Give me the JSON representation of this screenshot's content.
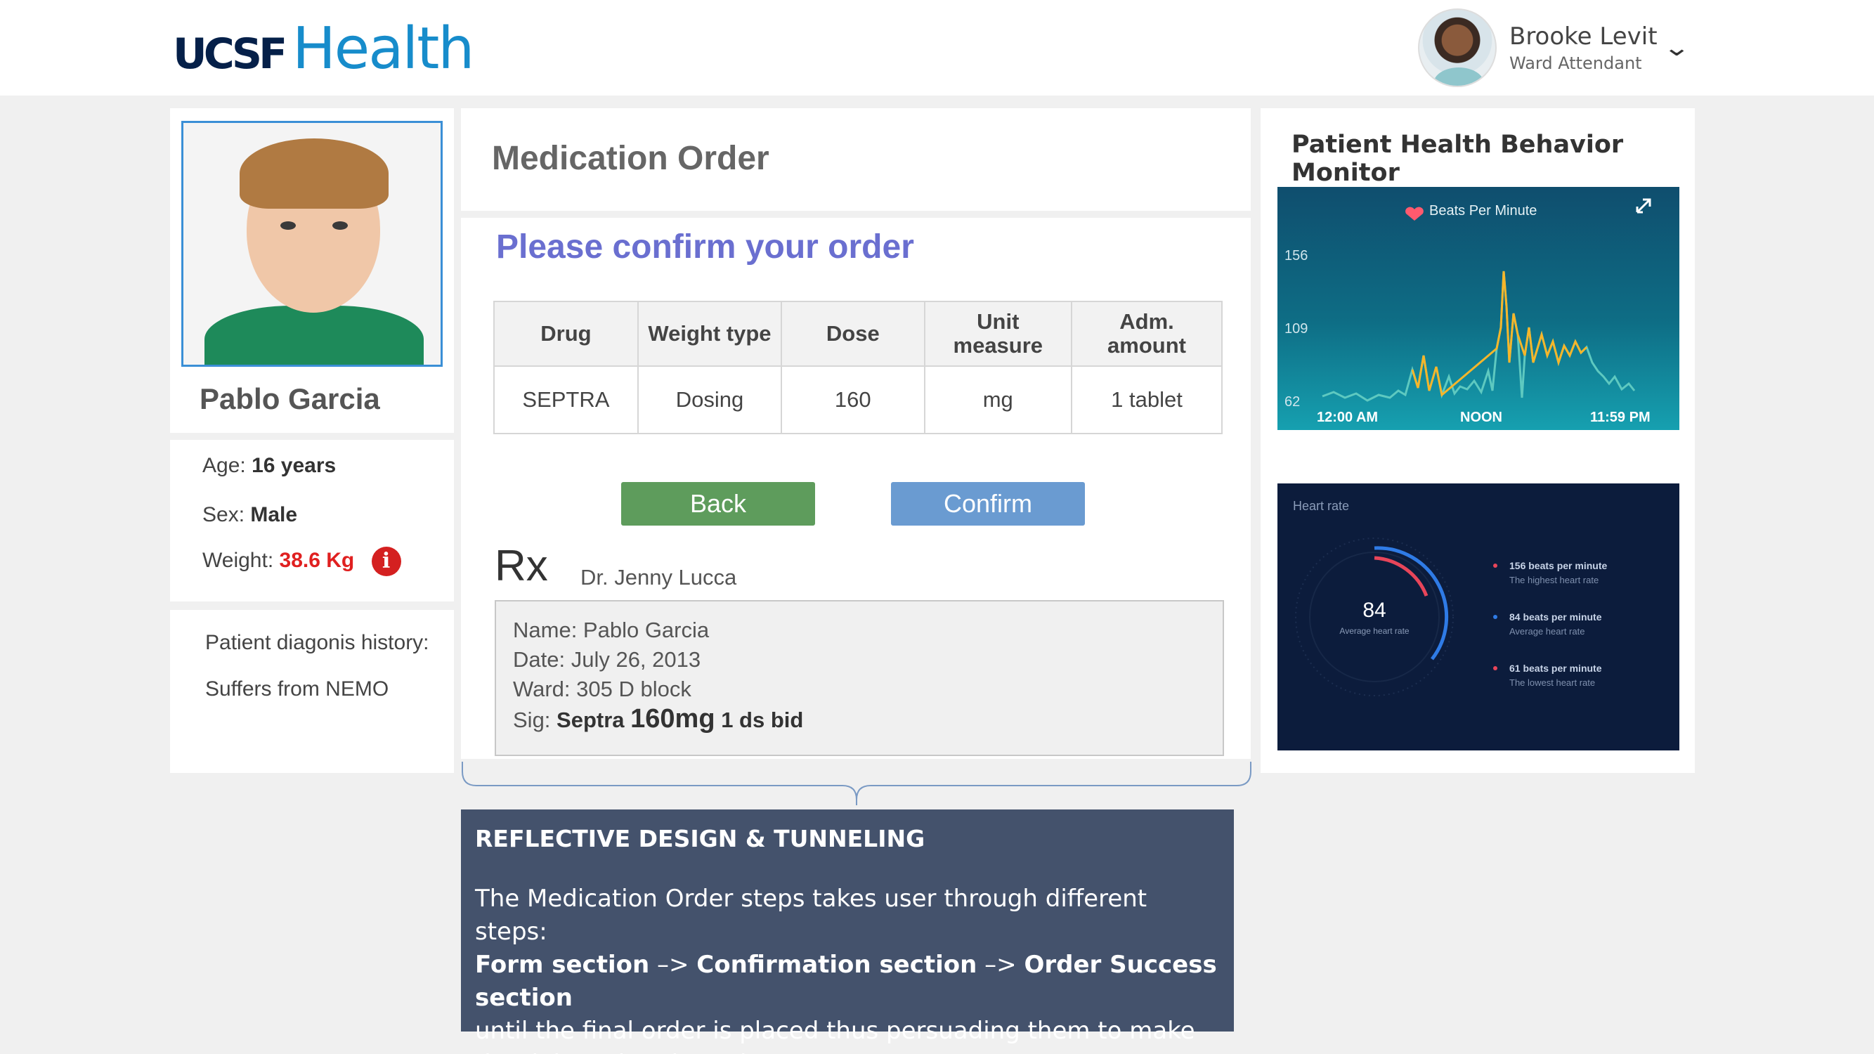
{
  "header": {
    "logo_ucsf": "UCSF",
    "logo_health": "Health",
    "user_name": "Brooke Levit",
    "user_role": "Ward Attendant"
  },
  "patient": {
    "name": "Pablo Garcia",
    "age_label": "Age:",
    "age_value": "16 years",
    "sex_label": "Sex:",
    "sex_value": "Male",
    "weight_label": "Weight:",
    "weight_value": "38.6 Kg",
    "history_label": "Patient diagonis history:",
    "history_value": "Suffers from NEMO"
  },
  "order": {
    "page_title": "Medication Order",
    "heading": "Please confirm your order",
    "columns": [
      "Drug",
      "Weight type",
      "Dose",
      "Unit measure",
      "Adm. amount"
    ],
    "row": [
      "SEPTRA",
      "Dosing",
      "160",
      "mg",
      "1 tablet"
    ],
    "back_label": "Back",
    "confirm_label": "Confirm",
    "rx_label": "Rx",
    "doctor": "Dr. Jenny Lucca",
    "sig": {
      "name": "Name: Pablo Garcia",
      "date": "Date: July 26, 2013",
      "ward": "Ward: 305 D block",
      "sig_label": "Sig:",
      "sig_drug": "Septra",
      "sig_dose": "160mg",
      "sig_freq": "1 ds bid"
    }
  },
  "callout": {
    "title": "REFLECTIVE DESIGN & TUNNELING",
    "line1": "The Medication Order steps takes user through different steps:",
    "step1": "Form section",
    "arrow": " –> ",
    "step2": "Confirmation section",
    "step3": "Order Success section",
    "line3": "until the final order is placed thus persuading them to make the right order along the way."
  },
  "monitor": {
    "title": "Patient Health Behavior Monitor",
    "bpm_title": "Beats Per Minute",
    "y_ticks": [
      "156",
      "109",
      "62"
    ],
    "x_ticks": [
      "12:00 AM",
      "NOON",
      "11:59 PM"
    ],
    "heart_rate_title": "Heart rate",
    "avg_value": "84",
    "avg_label": "Average heart rate",
    "legend": [
      {
        "value": "156 beats per minute",
        "desc": "The highest heart rate",
        "color": "#e8455a"
      },
      {
        "value": "84 beats per minute",
        "desc": "Average heart rate",
        "color": "#2f7be6"
      },
      {
        "value": "61 beats per minute",
        "desc": "The lowest heart rate",
        "color": "#e8455a"
      }
    ]
  },
  "colors": {
    "accent": "#6a6fd0",
    "back_button": "#5e9c5c",
    "confirm_button": "#6a9bd1",
    "alert": "#d42020",
    "callout_bg": "#44526c"
  }
}
